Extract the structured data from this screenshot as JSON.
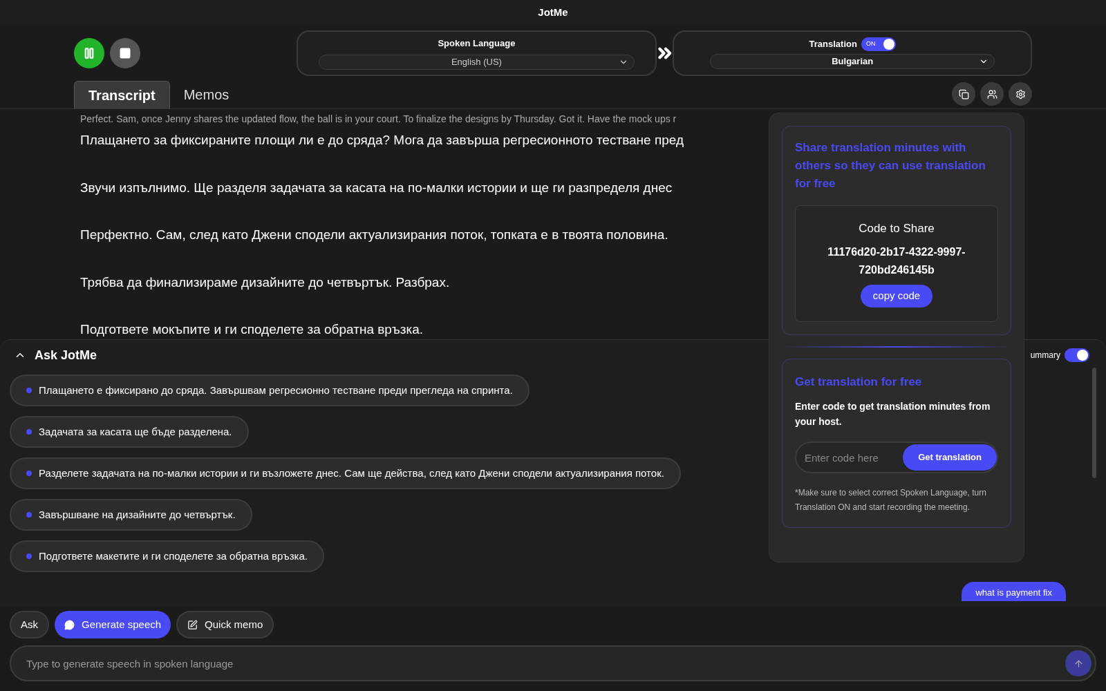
{
  "window": {
    "title": "JotMe"
  },
  "recording": {
    "paused": false
  },
  "spoken_language": {
    "label": "Spoken Language",
    "value": "English (US)"
  },
  "translation": {
    "label": "Translation",
    "on": true,
    "toggle_text": "ON",
    "value": "Bulgarian"
  },
  "tabs": [
    {
      "label": "Transcript",
      "selected": true
    },
    {
      "label": "Memos",
      "selected": false
    }
  ],
  "transcript": {
    "original": "Perfect. Sam, once Jenny shares the updated flow, the ball is in your court. To finalize the designs by Thursday. Got it. Have the mock ups r",
    "lines": [
      "Плащането за фиксираните площи ли е до сряда? Мога да завърша регресионното тестване пред",
      "Звучи изпълнимо. Ще разделя задачата за касата на по-малки истории и ще ги разпределя днес",
      "Перфектно. Сам, след като Джени сподели актуализирания поток, топката е в твоята половина.",
      "Трябва да финализираме дизайните до четвъртък. Разбрах.",
      "Подгответе мокъпите и ги споделете за обратна връзка."
    ]
  },
  "ask_panel": {
    "title": "Ask JotMe",
    "expanded": true,
    "summary_label": "ummary",
    "summary_on": true,
    "points": [
      "Плащането е фиксирано до сряда. Завършвам регресионно тестване преди прегледа на спринта.",
      "Задачата за касата ще бъде разделена.",
      "Разделете задачата на по-малки истории и ги възложете днес. Сам ще действа, след като Джени сподели актуализирания поток.",
      "Завършване на дизайните до четвъртък.",
      "Подгответе макетите и ги споделете за обратна връзка."
    ],
    "chat_bubble": "what is payment fix"
  },
  "modes": [
    {
      "label": "Ask",
      "selected": false,
      "kind": "plain"
    },
    {
      "label": "Generate speech",
      "selected": true,
      "kind": "speech"
    },
    {
      "label": "Quick memo",
      "selected": false,
      "kind": "memo"
    }
  ],
  "input": {
    "placeholder": "Type to generate speech in spoken language"
  },
  "share_popup": {
    "heading": "Share translation minutes with others so they can use translation for free",
    "code_label": "Code to Share",
    "code": "11176d20-2b17-4322-9997-720bd246145b",
    "copy_button": "copy code",
    "get_heading": "Get translation for free",
    "get_text": "Enter code to get translation minutes from your host.",
    "code_placeholder": "Enter code here",
    "get_button": "Get translation",
    "note": "*Make sure to select correct Spoken Language, turn Translation ON and start recording the meeting."
  }
}
